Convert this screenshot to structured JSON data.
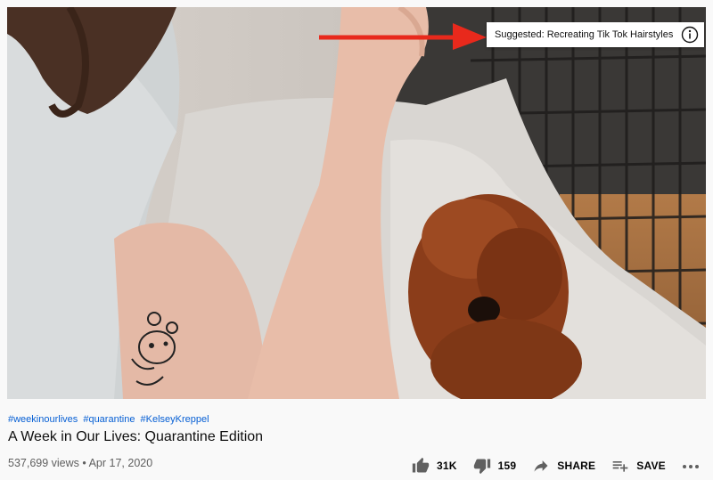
{
  "video": {
    "suggestion_label": "Suggested: Recreating Tik Tok Hairstyles",
    "hashtags": [
      "#weekinourlives",
      "#quarantine",
      "#KelseyKreppel"
    ],
    "title": "A Week in Our Lives: Quarantine Edition",
    "views": "537,699 views",
    "separator": "•",
    "date": "Apr 17, 2020"
  },
  "actions": {
    "like_count": "31K",
    "dislike_count": "159",
    "share_label": "SHARE",
    "save_label": "SAVE"
  },
  "icons": {
    "info": "info-icon",
    "like": "thumbs-up-icon",
    "dislike": "thumbs-down-icon",
    "share": "share-arrow-icon",
    "save": "add-to-playlist-icon",
    "more": "more-horizontal-icon",
    "annotation": "red-arrow-icon"
  },
  "colors": {
    "hashtag": "#065fd4",
    "arrow": "#e8291c",
    "text_primary": "#0f0f0f",
    "text_secondary": "#606060"
  }
}
